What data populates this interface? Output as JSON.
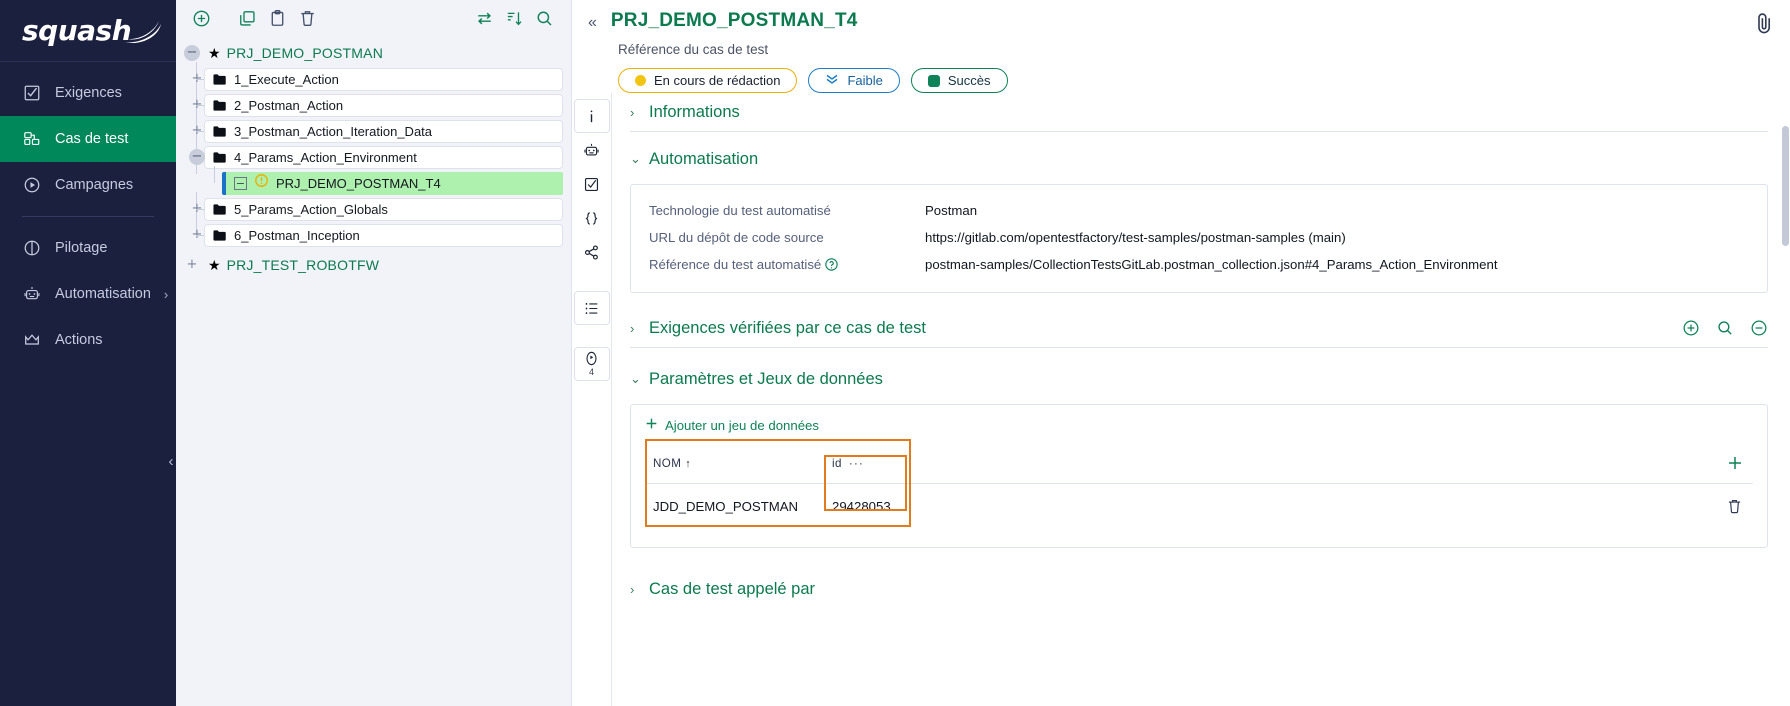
{
  "brand": {
    "name": "squash",
    "accent": "#00875a"
  },
  "sidebar": {
    "items": [
      {
        "label": "Exigences",
        "icon": "checklist-icon",
        "active": false
      },
      {
        "label": "Cas de test",
        "icon": "test-case-icon",
        "active": true
      },
      {
        "label": "Campagnes",
        "icon": "play-circle-icon",
        "active": false
      },
      {
        "label": "Pilotage",
        "icon": "pie-chart-icon",
        "active": false
      },
      {
        "label": "Automatisation",
        "icon": "robot-icon",
        "active": false,
        "expandable": true
      },
      {
        "label": "Actions",
        "icon": "crown-icon",
        "active": false
      }
    ]
  },
  "tree": {
    "toolbar": [
      {
        "name": "add-icon",
        "title": "Ajouter"
      },
      {
        "name": "copy-icon",
        "title": "Copier"
      },
      {
        "name": "paste-icon",
        "title": "Coller"
      },
      {
        "name": "delete-icon",
        "title": "Supprimer"
      },
      {
        "name": "move-icon",
        "title": "Déplacer"
      },
      {
        "name": "sort-icon",
        "title": "Trier"
      },
      {
        "name": "search-icon",
        "title": "Rechercher"
      }
    ],
    "projects": [
      {
        "label": "PRJ_DEMO_POSTMAN",
        "expanded": true,
        "children": [
          {
            "label": "1_Execute_Action",
            "type": "folder",
            "expanded": false
          },
          {
            "label": "2_Postman_Action",
            "type": "folder",
            "expanded": false
          },
          {
            "label": "3_Postman_Action_Iteration_Data",
            "type": "folder",
            "expanded": false
          },
          {
            "label": "4_Params_Action_Environment",
            "type": "folder",
            "expanded": true,
            "children": [
              {
                "label": "PRJ_DEMO_POSTMAN_T4",
                "type": "testcase",
                "selected": true
              }
            ]
          },
          {
            "label": "5_Params_Action_Globals",
            "type": "folder",
            "expanded": false
          },
          {
            "label": "6_Postman_Inception",
            "type": "folder",
            "expanded": false
          }
        ]
      },
      {
        "label": "PRJ_TEST_ROBOTFW",
        "expanded": false,
        "children": []
      }
    ]
  },
  "header": {
    "title": "PRJ_DEMO_POSTMAN_T4",
    "subtitle": "Référence du cas de test",
    "badges": [
      {
        "label": "En cours de rédaction",
        "kind": "status",
        "color": "#e8b10a"
      },
      {
        "label": "Faible",
        "kind": "priority",
        "color": "#1f7dc4"
      },
      {
        "label": "Succès",
        "kind": "result",
        "color": "#0f8257"
      }
    ],
    "attachment_icon": "paperclip-icon",
    "collapse_icon": "chevron-double-left-icon"
  },
  "rail": {
    "items": [
      {
        "name": "info-icon",
        "label": "i",
        "boxed": true,
        "count": null
      },
      {
        "name": "robot-icon",
        "label": "",
        "boxed": false,
        "count": null
      },
      {
        "name": "checkbox-icon",
        "label": "",
        "boxed": false,
        "count": null
      },
      {
        "name": "braces-icon",
        "label": "",
        "boxed": false,
        "count": null
      },
      {
        "name": "share-icon",
        "label": "",
        "boxed": false,
        "count": null
      },
      {
        "name": "list-icon",
        "label": "",
        "boxed": true,
        "count": null
      },
      {
        "name": "execution-icon",
        "label": "",
        "boxed": true,
        "count": "4"
      }
    ]
  },
  "sections": {
    "informations": {
      "title": "Informations",
      "expanded": false
    },
    "automatisation": {
      "title": "Automatisation",
      "expanded": true,
      "fields": [
        {
          "label": "Technologie du test automatisé",
          "value": "Postman",
          "help": false
        },
        {
          "label": "URL du dépôt de code source",
          "value": "https://gitlab.com/opentestfactory/test-samples/postman-samples (main)",
          "help": false
        },
        {
          "label": "Référence du test automatisé",
          "value": "postman-samples/CollectionTestsGitLab.postman_collection.json#4_Params_Action_Environment",
          "help": true
        }
      ]
    },
    "exigences": {
      "title": "Exigences vérifiées par ce cas de test",
      "expanded": false,
      "actions": [
        {
          "name": "add-circle-icon"
        },
        {
          "name": "search-icon"
        },
        {
          "name": "remove-circle-icon"
        }
      ]
    },
    "parametres": {
      "title": "Paramètres et Jeux de données",
      "expanded": true,
      "add_label": "Ajouter un jeu de données",
      "table": {
        "columns": [
          {
            "label": "NOM",
            "sorted": "asc",
            "sort_glyph": "↑"
          },
          {
            "label": "id",
            "menu_glyph": "···"
          }
        ],
        "rows": [
          {
            "nom": "JDD_DEMO_POSTMAN",
            "id": "29428053"
          }
        ],
        "add_column_icon": "plus-icon",
        "row_delete_icon": "trash-icon",
        "highlight_color": "#e07b1e"
      }
    },
    "appele_par": {
      "title": "Cas de test appelé par",
      "expanded": false
    }
  }
}
